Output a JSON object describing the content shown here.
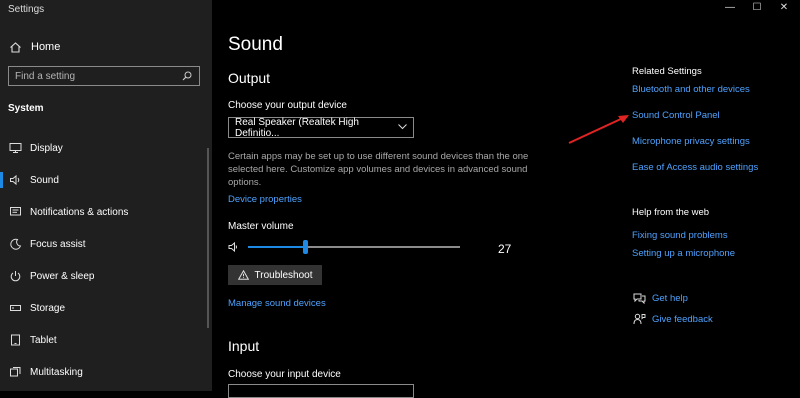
{
  "app_title": "Settings",
  "window_controls": {
    "minimize": "—",
    "maximize": "☐",
    "close": "✕"
  },
  "sidebar": {
    "home": "Home",
    "search_placeholder": "Find a setting",
    "section": "System",
    "items": [
      {
        "label": "Display",
        "icon": "display-icon"
      },
      {
        "label": "Sound",
        "icon": "speaker-icon",
        "active": true
      },
      {
        "label": "Notifications & actions",
        "icon": "notifications-icon"
      },
      {
        "label": "Focus assist",
        "icon": "moon-icon"
      },
      {
        "label": "Power & sleep",
        "icon": "power-icon"
      },
      {
        "label": "Storage",
        "icon": "storage-icon"
      },
      {
        "label": "Tablet",
        "icon": "tablet-icon"
      },
      {
        "label": "Multitasking",
        "icon": "multitasking-icon"
      }
    ]
  },
  "main": {
    "title": "Sound",
    "output_heading": "Output",
    "output_device_label": "Choose your output device",
    "output_device_value": "Real Speaker (Realtek High Definitio...",
    "description": "Certain apps may be set up to use different sound devices than the one selected here. Customize app volumes and devices in advanced sound options.",
    "device_properties": "Device properties",
    "master_volume_label": "Master volume",
    "master_volume_value": "27",
    "volume_fraction": 0.27,
    "troubleshoot": "Troubleshoot",
    "manage_devices": "Manage sound devices",
    "input_heading": "Input",
    "input_device_label": "Choose your input device"
  },
  "related": {
    "heading": "Related Settings",
    "links": [
      "Bluetooth and other devices",
      "Sound Control Panel",
      "Microphone privacy settings",
      "Ease of Access audio settings"
    ]
  },
  "help": {
    "heading": "Help from the web",
    "links": [
      "Fixing sound problems",
      "Setting up a microphone"
    ],
    "get_help": "Get help",
    "give_feedback": "Give feedback"
  },
  "colors": {
    "accent": "#1e88e5",
    "link": "#4ea2ff",
    "arrow": "#e02424"
  }
}
